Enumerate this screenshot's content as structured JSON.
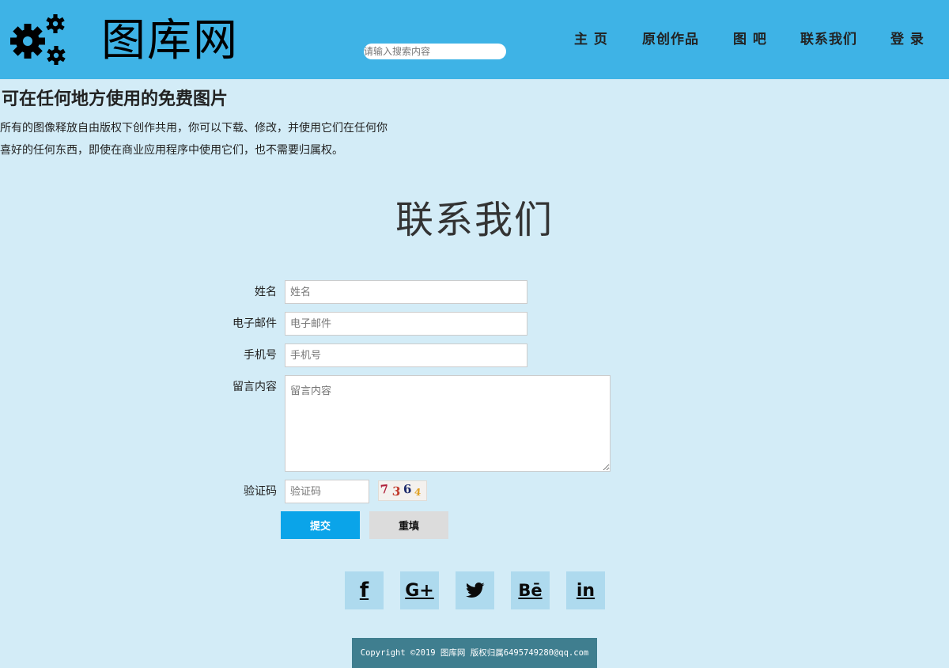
{
  "header": {
    "logo_text": "图库网",
    "search_placeholder": "请输入搜索内容",
    "nav": [
      "主 页",
      "原创作品",
      "图 吧",
      "联系我们",
      "登 录"
    ]
  },
  "hero": {
    "title": "可在任何地方使用的免费图片",
    "line1": "所有的图像释放自由版权下创作共用，你可以下载、修改，并使用它们在任何你",
    "line2": "喜好的任何东西，即使在商业应用程序中使用它们，也不需要归属权。"
  },
  "contact": {
    "title": "联系我们",
    "name_label": "姓名",
    "name_placeholder": "姓名",
    "email_label": "电子邮件",
    "email_placeholder": "电子邮件",
    "phone_label": "手机号",
    "phone_placeholder": "手机号",
    "message_label": "留言内容",
    "message_placeholder": "留言内容",
    "captcha_label": "验证码",
    "captcha_placeholder": "验证码",
    "captcha_chars": [
      "7",
      "3",
      "6",
      "4"
    ],
    "captcha_colors": [
      "#b0203a",
      "#c0392b",
      "#1c2a6b",
      "#e0a020"
    ],
    "submit_label": "提交",
    "reset_label": "重填"
  },
  "social": [
    {
      "icon": "facebook-icon",
      "glyph": "f"
    },
    {
      "icon": "google-plus-icon",
      "glyph": "G+"
    },
    {
      "icon": "twitter-icon",
      "glyph": ""
    },
    {
      "icon": "behance-icon",
      "glyph": "Bē"
    },
    {
      "icon": "linkedin-icon",
      "glyph": "in"
    }
  ],
  "footer": {
    "copyright": "Copyright ©2019 图库网 版权归属6495749280@qq.com"
  },
  "colors": {
    "header_bg": "#3eb3e6",
    "page_bg": "#d3ecf7",
    "submit_bg": "#0aa4e9",
    "reset_bg": "#dcdcdc",
    "social_bg": "#aedaee",
    "footer_bg": "#3f7e8f"
  }
}
